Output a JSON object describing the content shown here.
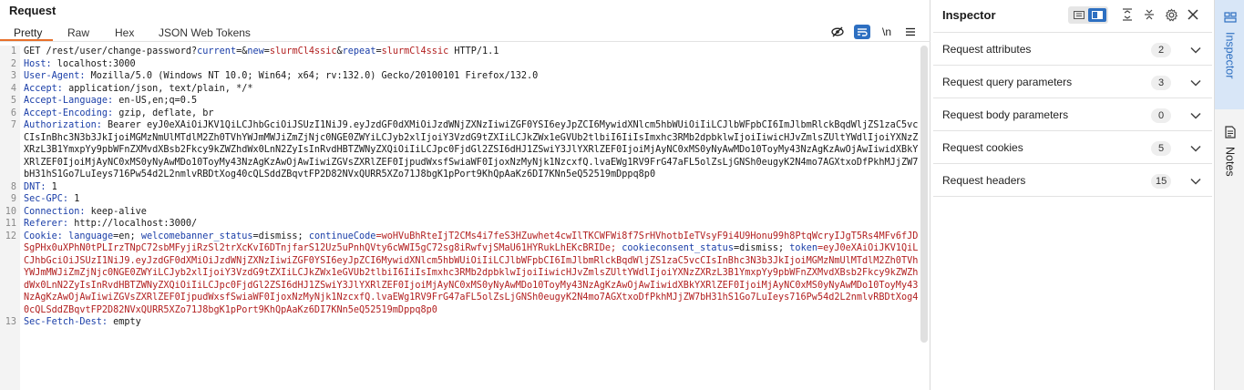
{
  "request": {
    "title": "Request",
    "tabs": [
      "Pretty",
      "Raw",
      "Hex",
      "JSON Web Tokens"
    ],
    "active_tab": "Pretty",
    "toolbar": {
      "hide_icon": "eye-slash-icon",
      "wrap_icon": "wrap-icon",
      "newline_label": "\\n",
      "menu_icon": "hamburger-icon"
    },
    "lines": {
      "l1": {
        "num": "1",
        "method_path": "GET /rest/user/change-password?",
        "p1k": "current",
        "eq1": "=&",
        "p2k": "new",
        "eq2": "=",
        "p2v": "slurmCl4ssic",
        "amp": "&",
        "p3k": "repeat",
        "eq3": "=",
        "p3v": "slurmCl4ssic",
        "proto": " HTTP/1.1"
      },
      "l2": {
        "num": "2",
        "name": "Host:",
        "value": " localhost:3000"
      },
      "l3": {
        "num": "3",
        "name": "User-Agent:",
        "value": " Mozilla/5.0 (Windows NT 10.0; Win64; x64; rv:132.0) Gecko/20100101 Firefox/132.0"
      },
      "l4": {
        "num": "4",
        "name": "Accept:",
        "value": " application/json, text/plain, */*"
      },
      "l5": {
        "num": "5",
        "name": "Accept-Language:",
        "value": " en-US,en;q=0.5"
      },
      "l6": {
        "num": "6",
        "name": "Accept-Encoding:",
        "value": " gzip, deflate, br"
      },
      "l7": {
        "num": "7",
        "name": "Authorization:",
        "value": " Bearer eyJ0eXAiOiJKV1QiLCJhbGciOiJSUzI1NiJ9.eyJzdGF0dXMiOiJzdWNjZXNzIiwiZGF0YSI6eyJpZCI6MywidXNlcm5hbWUiOiIiLCJlbWFpbCI6ImJlbmRlckBqdWljZS1zaC5vcCIsInBhc3N3b3JkIjoiMGMzNmUlMTdlM2Zh0TVhYWJmMWJiZmZjNjc0NGE0ZWYiLCJyb2xlIjoiY3VzdG9tZXIiLCJkZWx1eGVUb2tlbiI6IiIsImxhc3RMb2dpbklwIjoiIiwicHJvZmlsZUltYWdlIjoiYXNzZXRzL3B1YmxpYy9pbWFnZXMvdXBsb2Fkcy9kZWZhdWx0LnN2ZyIsInRvdHBTZWNyZXQiOiIiLCJpc0FjdGl2ZSI6dHJ1ZSwiY3JlYXRlZEF0IjoiMjAyNC0xMS0yNyAwMDo10ToyMy43NzAgKzAwOjAwIiwidXBkYXRlZEF0IjoiMjAyNC0xMS0yNyAwMDo10ToyMy43NzAgKzAwOjAwIiwiZGVsZXRlZEF0IjpudWxsfSwiaWF0IjoxNzMyNjk1NzcxfQ.lvaEWg1RV9FrG47aFL5olZsLjGNSh0eugyK2N4mo7AGXtxoDfPkhMJjZW7bH31hS1Go7LuIeys716Pw54d2L2nmlvRBDtXog40cQLSddZBqvtFP2D82NVxQURR5XZo71J8bgK1pPort9KhQpAaKz6DI7KNn5eQ52519mDppq8p0"
      },
      "l8": {
        "num": "8",
        "name": "DNT:",
        "value": " 1"
      },
      "l9": {
        "num": "9",
        "name": "Sec-GPC:",
        "value": " 1"
      },
      "l10": {
        "num": "10",
        "name": "Connection:",
        "value": " keep-alive"
      },
      "l11": {
        "num": "11",
        "name": "Referer:",
        "value": " http://localhost:3000/"
      },
      "l12": {
        "num": "12",
        "name": "Cookie:",
        "c1k": " language",
        "c1v": "=en; ",
        "c2k": "welcomebanner_status",
        "c2v": "=dismiss; ",
        "c3k": "continueCode",
        "c3v": "=woHVuBhRteIjT2CMs4i7feS3HZuwhet4cwIlTKCWFWi8f7SrHVhotbIeTVsyF9i4U9Honu99h8PtqWcryIJgT5Rs4MFv6fJDSgPHx0uXPhN0tPLIrzTNpC72sbMFyjiRzSl2trXcKvI6DTnjfarS12Uz5uPnhQVty6cWWI5gC72sg8iRwfvjSMaU61HYRukLhEKcBRIDe; ",
        "c4k": "cookieconsent_status",
        "c4v": "=dismiss; ",
        "c5k": "token",
        "c5v": "=eyJ0eXAiOiJKV1QiLCJhbGciOiJSUzI1NiJ9.eyJzdGF0dXMiOiJzdWNjZXNzIiwiZGF0YSI6eyJpZCI6MywidXNlcm5hbWUiOiIiLCJlbWFpbCI6ImJlbmRlckBqdWljZS1zaC5vcCIsInBhc3N3b3JkIjoiMGMzNmUlMTdlM2Zh0TVhYWJmMWJiZmZjNjc0NGE0ZWYiLCJyb2xlIjoiY3VzdG9tZXIiLCJkZWx1eGVUb2tlbiI6IiIsImxhc3RMb2dpbklwIjoiIiwicHJvZmlsZUltYWdlIjoiYXNzZXRzL3B1YmxpYy9pbWFnZXMvdXBsb2Fkcy9kZWZhdWx0LnN2ZyIsInRvdHBTZWNyZXQiOiIiLCJpc0FjdGl2ZSI6dHJ1ZSwiY3JlYXRlZEF0IjoiMjAyNC0xMS0yNyAwMDo10ToyMy43NzAgKzAwOjAwIiwidXBkYXRlZEF0IjoiMjAyNC0xMS0yNyAwMDo10ToyMy43NzAgKzAwOjAwIiwiZGVsZXRlZEF0IjpudWxsfSwiaWF0IjoxNzMyNjk1NzcxfQ.lvaEWg1RV9FrG47aFL5olZsLjGNSh0eugyK2N4mo7AGXtxoDfPkhMJjZW7bH31hS1Go7LuIeys716Pw54d2L2nmlvRBDtXog40cQLSddZBqvtFP2D82NVxQURR5XZo71J8bgK1pPort9KhQpAaKz6DI7KNn5eQ52519mDppq8p0"
      },
      "l13": {
        "num": "13",
        "name": "Sec-Fetch-Dest:",
        "value": " empty"
      }
    }
  },
  "inspector": {
    "title": "Inspector",
    "rows": [
      {
        "label": "Request attributes",
        "count": "2"
      },
      {
        "label": "Request query parameters",
        "count": "3"
      },
      {
        "label": "Request body parameters",
        "count": "0"
      },
      {
        "label": "Request cookies",
        "count": "5"
      },
      {
        "label": "Request headers",
        "count": "15"
      }
    ]
  },
  "rail": {
    "inspector_label": "Inspector",
    "notes_label": "Notes"
  },
  "colors": {
    "accent": "#e8702a",
    "selected_blue": "#2d6fc1",
    "header_name": "#1a3ea8",
    "param_value": "#b22020"
  }
}
